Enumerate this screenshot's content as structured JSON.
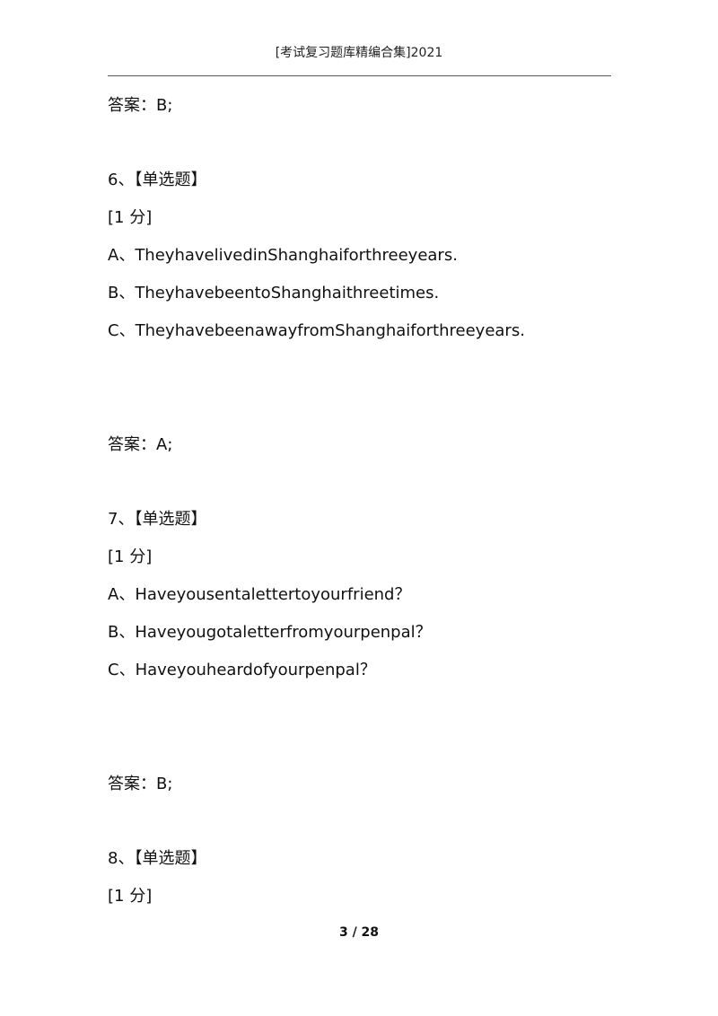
{
  "header": {
    "title": "[考试复习题库精编合集]2021"
  },
  "content": {
    "answer_5": "答案：B;",
    "q6": {
      "heading": "6、【单选题】",
      "score": "[1 分]",
      "options": [
        "A、TheyhavelivedinShanghaiforthreeyears.",
        "B、TheyhavebeentoShanghaithreetimes.",
        "C、TheyhavebeenawayfromShanghaiforthreeyears."
      ],
      "answer": "答案：A;"
    },
    "q7": {
      "heading": "7、【单选题】",
      "score": "[1 分]",
      "options": [
        "A、Haveyousentalettertoyourfriend？",
        "B、Haveyougotaletterfromyourpenpal？",
        "C、Haveyouheardofyourpenpal？"
      ],
      "answer": "答案：B;"
    },
    "q8": {
      "heading": "8、【单选题】",
      "score": "[1 分]"
    }
  },
  "footer": {
    "page": "3 / 28"
  }
}
